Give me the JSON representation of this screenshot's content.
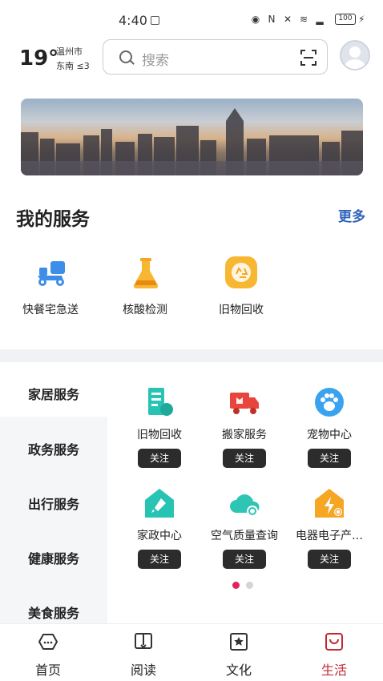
{
  "status_bar": {
    "time": "4:40",
    "battery": "100"
  },
  "header": {
    "temperature": "19°",
    "city": "温州市",
    "wind": "东南 ≤3",
    "search_placeholder": "搜索"
  },
  "my_services": {
    "title": "我的服务",
    "more": "更多",
    "items": [
      {
        "label": "快餐宅急送",
        "icon": "delivery-scooter-icon"
      },
      {
        "label": "核酸检测",
        "icon": "test-beaker-icon"
      },
      {
        "label": "旧物回收",
        "icon": "recycle-icon"
      }
    ]
  },
  "categories": {
    "tabs": [
      "家居服务",
      "政务服务",
      "出行服务",
      "健康服务",
      "美食服务"
    ],
    "selected": "家居服务",
    "items": [
      {
        "label": "旧物回收",
        "icon": "recycle-building-icon",
        "action": "关注"
      },
      {
        "label": "搬家服务",
        "icon": "moving-truck-icon",
        "action": "关注"
      },
      {
        "label": "宠物中心",
        "icon": "pet-paw-icon",
        "action": "关注"
      },
      {
        "label": "家政中心",
        "icon": "housekeeping-icon",
        "action": "关注"
      },
      {
        "label": "空气质量查询",
        "icon": "air-quality-cloud-icon",
        "action": "关注"
      },
      {
        "label": "电器电子产…",
        "icon": "appliance-bolt-icon",
        "action": "关注"
      }
    ],
    "page_count": 2,
    "current_page": 1
  },
  "bottom_nav": {
    "items": [
      {
        "label": "首页",
        "icon": "home-icon"
      },
      {
        "label": "阅读",
        "icon": "book-icon"
      },
      {
        "label": "文化",
        "icon": "culture-star-icon"
      },
      {
        "label": "生活",
        "icon": "life-bag-icon"
      }
    ],
    "active": "生活"
  },
  "colors": {
    "accent_red": "#c22a30",
    "more_blue": "#2d63b9",
    "teal": "#27c4b4",
    "orange": "#f5a623"
  }
}
